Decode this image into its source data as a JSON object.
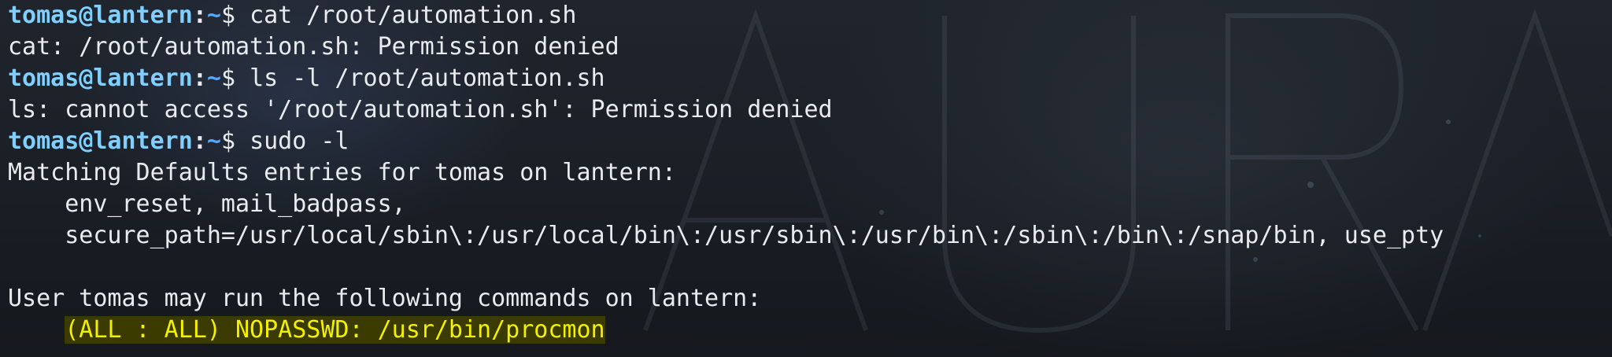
{
  "terminal": {
    "prompt": {
      "user_host": "tomas@lantern",
      "colon": ":",
      "cwd": "~",
      "symbol": "$ "
    },
    "commands": [
      "cat /root/automation.sh",
      "ls -l /root/automation.sh",
      "sudo -l"
    ],
    "output": {
      "cat_error": "cat: /root/automation.sh: Permission denied",
      "ls_error": "ls: cannot access '/root/automation.sh': Permission denied",
      "matching_defaults": "Matching Defaults entries for tomas on lantern:",
      "defaults_1": "    env_reset, mail_badpass,",
      "defaults_2": "    secure_path=/usr/local/sbin\\:/usr/local/bin\\:/usr/sbin\\:/usr/bin\\:/sbin\\:/bin\\:/snap/bin, use_pty",
      "may_run": "User tomas may run the following commands on lantern:",
      "indent": "    ",
      "sudo_rule": "(ALL : ALL) NOPASSWD: /usr/bin/procmon"
    }
  },
  "colors": {
    "prompt_user": "#7fd0ff",
    "prompt_cwd": "#5aa7ff",
    "text": "#e9ecef",
    "highlight_fg": "#f3f000",
    "highlight_bg": "#3b3b00"
  }
}
